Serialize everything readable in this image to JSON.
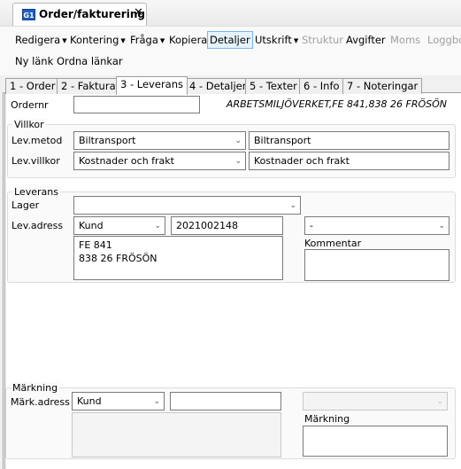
{
  "window": {
    "tab_title": "Order/fakturering",
    "icon_label": "G1"
  },
  "toolbar": {
    "row1": [
      {
        "label": "Redigera",
        "dropdown": true,
        "enabled": true
      },
      {
        "label": "Kontering",
        "dropdown": true,
        "enabled": true
      },
      {
        "label": "Fråga",
        "dropdown": true,
        "enabled": true
      },
      {
        "label": "Kopiera",
        "dropdown": false,
        "enabled": true
      },
      {
        "label": "Detaljer",
        "dropdown": false,
        "enabled": true,
        "selected": true
      },
      {
        "label": "Utskrift",
        "dropdown": true,
        "enabled": true
      },
      {
        "label": "Struktur",
        "dropdown": false,
        "enabled": false
      },
      {
        "label": "Avgifter",
        "dropdown": false,
        "enabled": true
      },
      {
        "label": "Moms",
        "dropdown": false,
        "enabled": false
      },
      {
        "label": "Loggbo",
        "dropdown": false,
        "enabled": false
      }
    ],
    "row2": [
      {
        "label": "Ny länk"
      },
      {
        "label": "Ordna länkar"
      }
    ]
  },
  "tabs": [
    {
      "label": "1 - Order"
    },
    {
      "label": "2 - Faktura"
    },
    {
      "label": "3 - Leverans",
      "active": true
    },
    {
      "label": "4 - Detaljer"
    },
    {
      "label": "5 - Texter"
    },
    {
      "label": "6 - Info"
    },
    {
      "label": "7 - Noteringar"
    }
  ],
  "form": {
    "ordernr": {
      "label": "Ordernr",
      "value": ""
    },
    "customer_info": "ARBETSMILJÖVERKET,FE 841,838 26 FRÖSÖN",
    "villkor": {
      "title": "Villkor",
      "lev_metod": {
        "label": "Lev.metod",
        "selected": "Biltransport",
        "text": "Biltransport"
      },
      "lev_villkor": {
        "label": "Lev.villkor",
        "selected": "Kostnader och frakt",
        "text": "Kostnader och frakt"
      }
    },
    "leverans": {
      "title": "Leverans",
      "lager": {
        "label": "Lager",
        "selected": ""
      },
      "lev_adress": {
        "label": "Lev.adress",
        "type": "Kund",
        "number": "2021002148",
        "extra": "-",
        "address_line1": "FE 841",
        "address_line2": "838 26 FRÖSÖN"
      },
      "kommentar": {
        "label": "Kommentar",
        "value": ""
      }
    },
    "markning": {
      "title": "Märkning",
      "mark_adress": {
        "label": "Märk.adress",
        "type": "Kund",
        "number": "",
        "extra": ""
      },
      "markning_field": {
        "label": "Märkning",
        "value": ""
      }
    }
  }
}
